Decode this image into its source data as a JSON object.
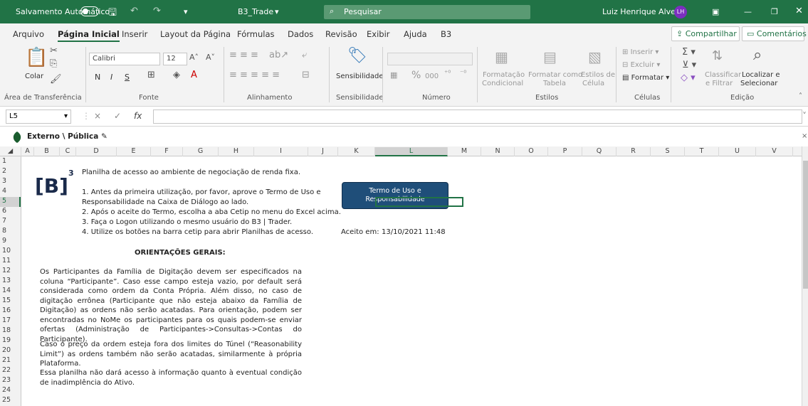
{
  "titlebar": {
    "autosave": "Salvamento Automático",
    "filename": "B3_Trade",
    "search_placeholder": "Pesquisar",
    "user": "Luiz Henrique Alves",
    "initials": "LH"
  },
  "menu": {
    "tabs": [
      "Arquivo",
      "Página Inicial",
      "Inserir",
      "Layout da Página",
      "Fórmulas",
      "Dados",
      "Revisão",
      "Exibir",
      "Ajuda",
      "B3"
    ],
    "share": "Compartilhar",
    "comments": "Comentários"
  },
  "ribbon": {
    "clipboard": {
      "paste": "Colar",
      "group": "Área de Transferência"
    },
    "font": {
      "name": "Calibri",
      "size": "12",
      "bold": "N",
      "italic": "I",
      "underline": "S",
      "group": "Fonte"
    },
    "alignment": {
      "group": "Alinhamento"
    },
    "sensitivity": {
      "label": "Sensibilidade",
      "group": "Sensibilidade"
    },
    "number": {
      "group": "Número",
      "percent": "%",
      "thousands": "000"
    },
    "styles": {
      "cond": "Formatação",
      "cond2": "Condicional",
      "table": "Formatar como",
      "table2": "Tabela",
      "cell": "Estilos de",
      "cell2": "Célula",
      "group": "Estilos"
    },
    "cells": {
      "insert": "Inserir",
      "delete": "Excluir",
      "format": "Formatar",
      "group": "Células"
    },
    "editing": {
      "sort": "Classificar",
      "sort2": "e Filtrar",
      "find": "Localizar e",
      "find2": "Selecionar",
      "group": "Edição"
    }
  },
  "formula_bar": {
    "name_box": "L5",
    "cancel": "×",
    "enter": "✓",
    "fx": "fx",
    "value": ""
  },
  "sensitivity_bar": {
    "label": "Externo \\ Pública"
  },
  "grid": {
    "columns": [
      "A",
      "B",
      "C",
      "D",
      "E",
      "F",
      "G",
      "H",
      "I",
      "J",
      "K",
      "L",
      "M",
      "N",
      "O",
      "P",
      "Q",
      "R",
      "S",
      "T",
      "U",
      "V"
    ],
    "rows": [
      "1",
      "2",
      "3",
      "4",
      "5",
      "6",
      "7",
      "8",
      "9",
      "10",
      "11",
      "12",
      "13",
      "14",
      "15",
      "16",
      "17",
      "18",
      "19",
      "20",
      "21",
      "22",
      "23",
      "24",
      "25"
    ],
    "selected_cell": "L5"
  },
  "content": {
    "logo": "[B]",
    "logo_sup": "3",
    "intro": "Planilha de acesso ao ambiente de negociação de renda fixa.",
    "step1a": "1. Antes da primeira utilização, por favor, aprove o Termo de Uso e",
    "step1b": "Responsabilidade na Caixa de Diálogo ao lado.",
    "step2": "2. Após o aceite do Termo, escolha a aba Cetip no menu do Excel acima.",
    "step3": "3. Faça o Logon utilizando o mesmo usuário do B3 | Trader.",
    "step4": "4. Utilize os botões na barra cetip para abrir Planilhas de acesso.",
    "accepted_label": "Aceito em:",
    "accepted_value": "13/10/2021 11:48",
    "term_button_line1": "Termo de  Uso e",
    "term_button_line2": "Responsabilidade",
    "heading": "ORIENTAÇÕES GERAIS:",
    "para1": "Os Participantes da Família de Digitação devem ser especificados na coluna “Participante”. Caso esse campo esteja vazio, por default será considerada como ordem da Conta Própria. Além disso, no caso de digitação errônea (Participante que não esteja abaixo da Família de Digitação) as ordens não serão acatadas. Para orientação, podem ser encontradas no NoMe os participantes para os quais podem-se enviar ofertas (Administração de Participantes->Consultas->Contas do Participante).",
    "para2": "Caso o preço da ordem esteja fora dos limites do Túnel (“Reasonability Limit”) as ordens também não serão acatadas, similarmente à própria Plataforma.",
    "para3": "Essa planilha não dará acesso à informação quanto à eventual condição de inadimplência do Ativo."
  }
}
